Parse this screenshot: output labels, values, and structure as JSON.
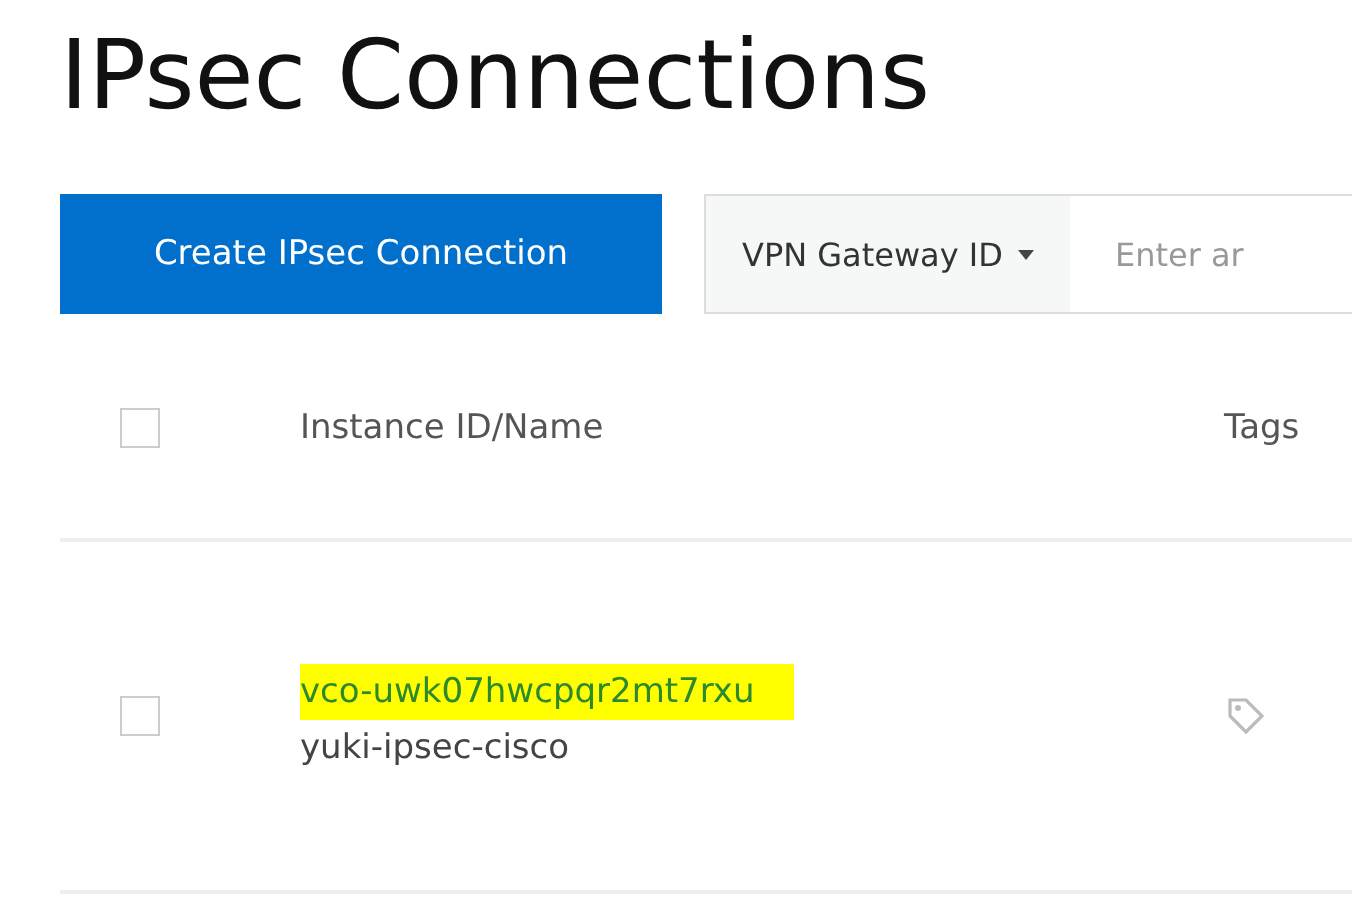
{
  "page": {
    "title": "IPsec Connections"
  },
  "toolbar": {
    "create_button": "Create IPsec Connection",
    "filter_dropdown": "VPN Gateway ID",
    "search": {
      "placeholder": "Enter ar"
    }
  },
  "table": {
    "columns": [
      "Instance ID/Name",
      "Tags"
    ],
    "header_checkbox": {
      "checked": false
    },
    "rows": [
      {
        "id": "vco-uwk07hwcpqr2mt7rxu",
        "name": "yuki-ipsec-cisco",
        "highlighted": true,
        "checked": false
      }
    ]
  }
}
